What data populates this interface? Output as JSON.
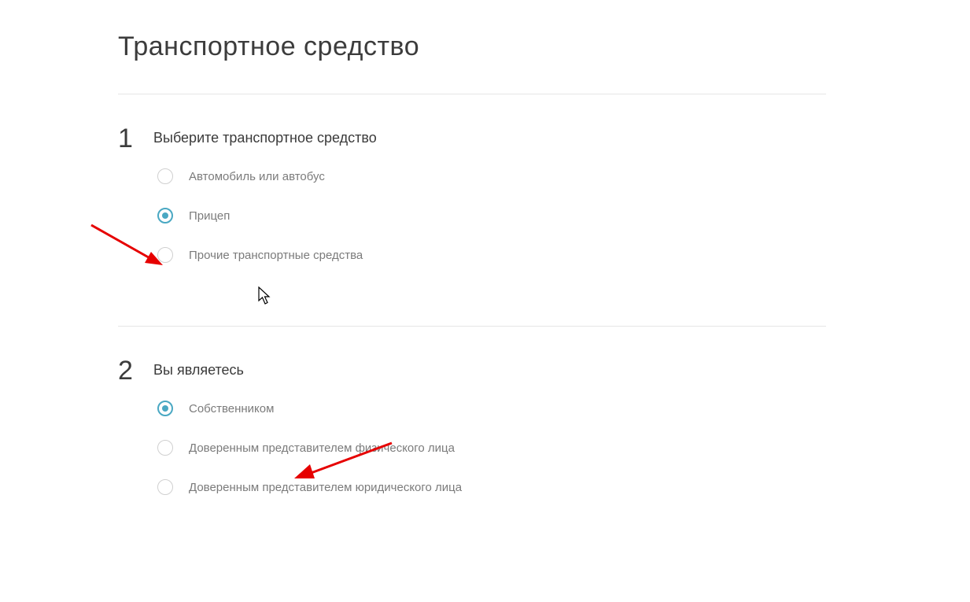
{
  "title": "Транспортное средство",
  "steps": [
    {
      "number": "1",
      "title": "Выберите транспортное средство",
      "options": [
        {
          "label": "Автомобиль или автобус",
          "selected": false
        },
        {
          "label": "Прицеп",
          "selected": true
        },
        {
          "label": "Прочие транспортные средства",
          "selected": false
        }
      ]
    },
    {
      "number": "2",
      "title": "Вы являетесь",
      "options": [
        {
          "label": "Собственником",
          "selected": true
        },
        {
          "label": "Доверенным представителем физического лица",
          "selected": false
        },
        {
          "label": "Доверенным представителем юридического лица",
          "selected": false
        }
      ]
    }
  ],
  "annotation_color": "#e60000"
}
